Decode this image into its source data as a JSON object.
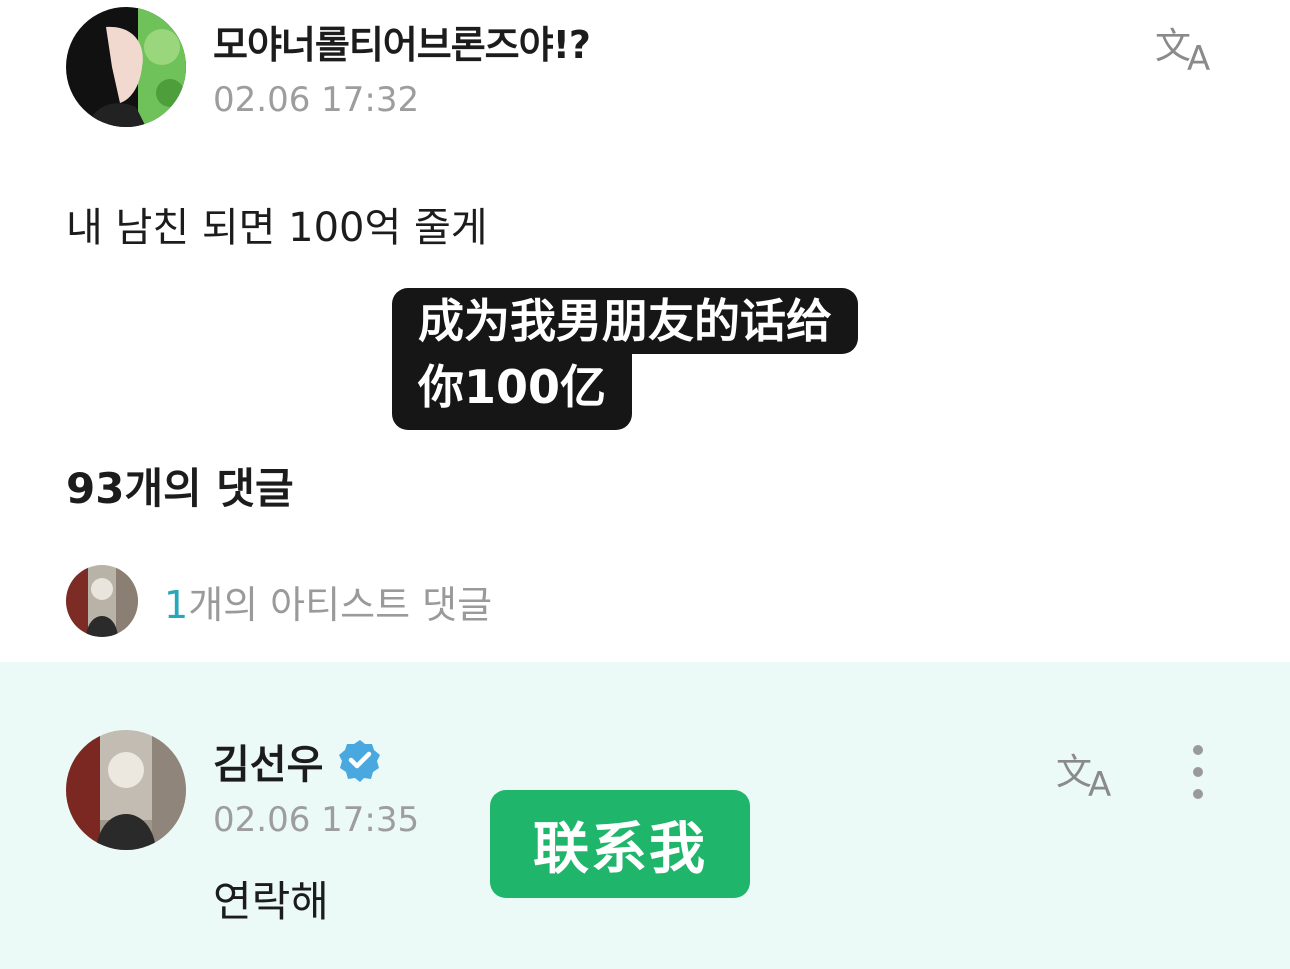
{
  "post": {
    "author": "모야너롤티어브론즈야!?",
    "timestamp": "02.06 17:32",
    "body": "내 남친 되면 100억 줄게"
  },
  "caption": {
    "line1": "成为我男朋友的话给",
    "line2": "你100亿"
  },
  "comments": {
    "count_label": "93개의 댓글",
    "artist_count_number": "1",
    "artist_count_text": "개의 아티스트 댓글"
  },
  "artist_comment": {
    "author": "김선우",
    "timestamp": "02.06 17:35",
    "body": "연락해",
    "caption": "联系我"
  },
  "icons": {
    "translate": "translate-icon",
    "verified": "verified-badge-icon",
    "more": "more-vertical-icon"
  },
  "colors": {
    "accent_teal": "#27a7bb",
    "verified_blue": "#4aa8e0",
    "card_background": "#ebfaf7",
    "caption_green": "#1fb56a"
  }
}
